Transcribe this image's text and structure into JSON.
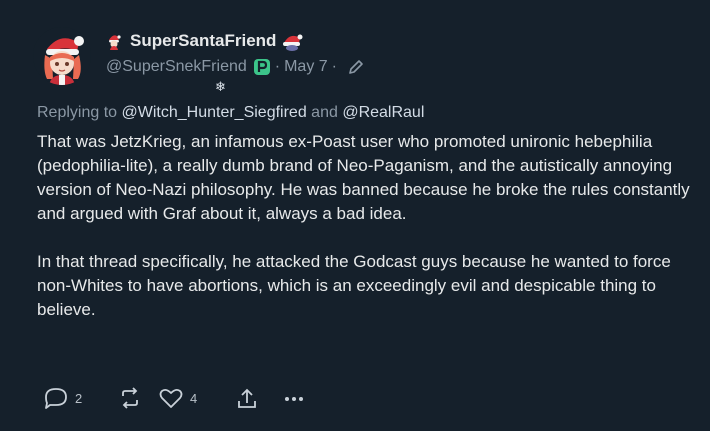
{
  "post": {
    "display_name": "SuperSantaFriend",
    "handle": "@SuperSnekFriend",
    "date": "May 7",
    "meta_separator_1": "·",
    "meta_separator_2": "·",
    "replying": {
      "prefix": "Replying to",
      "mention_1": "@Witch_Hunter_Siegfired",
      "conjunction": "and",
      "mention_2": "@RealRaul"
    },
    "paragraphs": [
      "That was JetzKrieg, an infamous ex-Poast user who promoted unironic hebephilia (pedophilia-lite), a really dumb brand of Neo-Paganism, and the autistically annoying version of Neo-Nazi philosophy. He was banned because he broke the rules constantly and argued with Graf about it, always a bad idea.",
      "In that thread specifically, he attacked the Godcast guys because he wanted to force non-Whites to have abortions, which is an exceedingly evil and despicable thing to believe."
    ],
    "actions": {
      "reply_count": "2",
      "like_count": "4"
    },
    "decoration": "❄"
  },
  "icons": {
    "avatar": "santa-hat-anime-avatar",
    "name_prefix_emoji": "santa-emoji",
    "name_suffix_emoji": "santa-hat-emoji",
    "badge": "verified-p-badge",
    "edit": "pencil-icon",
    "reply": "speech-bubble-icon",
    "repost": "repost-icon",
    "like": "heart-icon",
    "share": "share-icon",
    "more": "more-dots-icon"
  },
  "colors": {
    "background": "#15202b",
    "text": "#e7e9ea",
    "muted": "#8b98a5",
    "badge": "#3cc48a"
  }
}
